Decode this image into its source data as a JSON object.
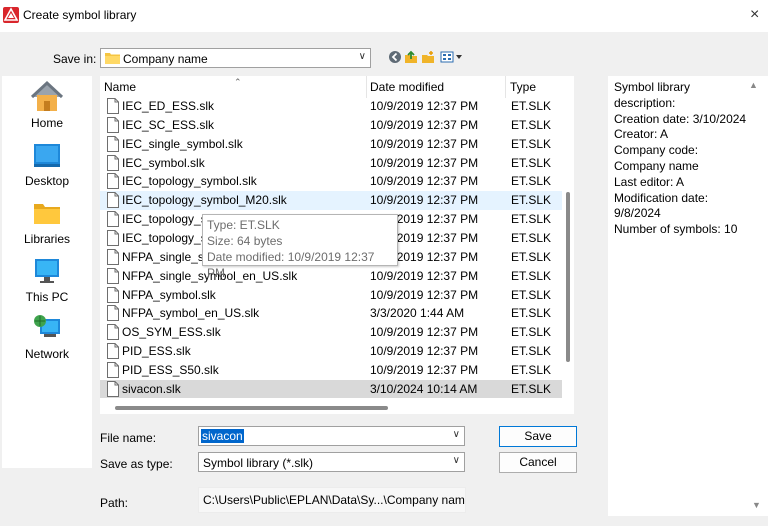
{
  "window": {
    "title": "Create symbol library",
    "close_glyph": "×"
  },
  "save_in": {
    "label": "Save in:",
    "value": "Company name"
  },
  "toolbar_icons": [
    "back-icon",
    "up-folder-icon",
    "new-folder-icon",
    "view-menu-icon"
  ],
  "places": [
    {
      "label": "Home",
      "icon": "home-icon"
    },
    {
      "label": "Desktop",
      "icon": "desktop-icon"
    },
    {
      "label": "Libraries",
      "icon": "libraries-icon"
    },
    {
      "label": "This PC",
      "icon": "this-pc-icon"
    },
    {
      "label": "Network",
      "icon": "network-icon"
    }
  ],
  "columns": {
    "name": "Name",
    "date": "Date modified",
    "type": "Type"
  },
  "files": [
    {
      "name": "IEC_ED_ESS.slk",
      "date": "10/9/2019 12:37 PM",
      "type": "ET.SLK"
    },
    {
      "name": "IEC_SC_ESS.slk",
      "date": "10/9/2019 12:37 PM",
      "type": "ET.SLK"
    },
    {
      "name": "IEC_single_symbol.slk",
      "date": "10/9/2019 12:37 PM",
      "type": "ET.SLK"
    },
    {
      "name": "IEC_symbol.slk",
      "date": "10/9/2019 12:37 PM",
      "type": "ET.SLK"
    },
    {
      "name": "IEC_topology_symbol.slk",
      "date": "10/9/2019 12:37 PM",
      "type": "ET.SLK"
    },
    {
      "name": "IEC_topology_symbol_M20.slk",
      "date": "10/9/2019 12:37 PM",
      "type": "ET.SLK"
    },
    {
      "name": "IEC_topology_sy",
      "date": "10/9/2019 12:37 PM",
      "type": "ET.SLK"
    },
    {
      "name": "IEC_topology_sy",
      "date": "10/9/2019 12:37 PM",
      "type": "ET.SLK"
    },
    {
      "name": "NFPA_single_syr",
      "date": "10/9/2019 12:37 PM",
      "type": "ET.SLK"
    },
    {
      "name": "NFPA_single_symbol_en_US.slk",
      "date": "10/9/2019 12:37 PM",
      "type": "ET.SLK"
    },
    {
      "name": "NFPA_symbol.slk",
      "date": "10/9/2019 12:37 PM",
      "type": "ET.SLK"
    },
    {
      "name": "NFPA_symbol_en_US.slk",
      "date": "3/3/2020 1:44 AM",
      "type": "ET.SLK"
    },
    {
      "name": "OS_SYM_ESS.slk",
      "date": "10/9/2019 12:37 PM",
      "type": "ET.SLK"
    },
    {
      "name": "PID_ESS.slk",
      "date": "10/9/2019 12:37 PM",
      "type": "ET.SLK"
    },
    {
      "name": "PID_ESS_S50.slk",
      "date": "10/9/2019 12:37 PM",
      "type": "ET.SLK"
    },
    {
      "name": "sivacon.slk",
      "date": "3/10/2024 10:14 AM",
      "type": "ET.SLK"
    }
  ],
  "tooltip": {
    "type": "Type: ET.SLK",
    "size": "Size: 64 bytes",
    "modified": "Date modified: 10/9/2019 12:37 PM"
  },
  "form": {
    "file_name_label": "File name:",
    "file_name_value": "sivacon",
    "save_as_type_label": "Save as type:",
    "save_as_type_value": "Symbol library (*.slk)",
    "save_button": "Save",
    "cancel_button": "Cancel",
    "path_label": "Path:",
    "path_value": "C:\\Users\\Public\\EPLAN\\Data\\Sy...\\Company name"
  },
  "description": "Symbol library\ndescription:\nCreation date: 3/10/2024\nCreator: A\nCompany code:\nCompany name\nLast editor: A\nModification date:\n9/8/2024\nNumber of symbols: 10",
  "colors": {
    "accent": "#0078d7",
    "selection": "#0066cc",
    "hover_row": "#e5f3ff",
    "selected_row": "#d9d9d9",
    "app_red": "#d9262c"
  }
}
